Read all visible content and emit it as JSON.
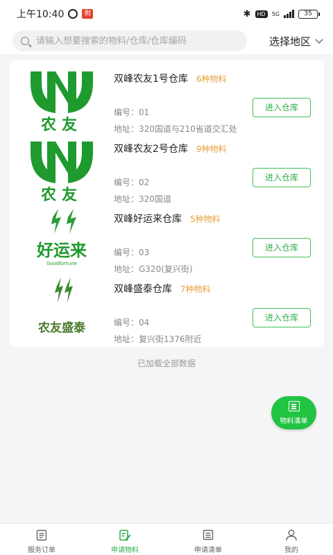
{
  "status_bar": {
    "time": "上午10:40",
    "notif_badge": "附",
    "network": "5G",
    "hd": "HD",
    "battery": "35"
  },
  "header": {
    "search_placeholder": "请输入想要搜索的物料/仓库/仓库编码",
    "region_label": "选择地区"
  },
  "warehouses": [
    {
      "name": "双峰农友1号仓库",
      "count": "6种物料",
      "code": "编号：01",
      "address": "地址：320国道与210省道交汇处",
      "button": "进入仓库",
      "logo": "nongyou-logo"
    },
    {
      "name": "双峰农友2号仓库",
      "count": "9种物料",
      "code": "编号：02",
      "address": "地址：320国道",
      "button": "进入仓库",
      "logo": "nongyou-logo"
    },
    {
      "name": "双峰好运来仓库",
      "count": "5种物料",
      "code": "编号：03",
      "address": "地址：G320(复兴街)",
      "button": "进入仓库",
      "logo": "haoyunlai-logo"
    },
    {
      "name": "双峰盛泰仓库",
      "count": "7种物料",
      "code": "编号：04",
      "address": "地址：复兴街1376附近",
      "button": "进入仓库",
      "logo": "nongyou-shengtai-logo"
    }
  ],
  "logo_text": {
    "nongyou": "农友",
    "haoyunlai": "好运来",
    "goodfortune": "Goodfortune",
    "shengtai": "农友盛泰"
  },
  "list_footer": "已加载全部数据",
  "fab": {
    "label": "物料清单"
  },
  "tabs": [
    {
      "label": "服务订单",
      "icon": "clipboard-icon"
    },
    {
      "label": "申请物料",
      "icon": "edit-document-icon"
    },
    {
      "label": "申请清单",
      "icon": "list-document-icon"
    },
    {
      "label": "我的",
      "icon": "person-icon"
    }
  ],
  "colors": {
    "accent": "#2fae49",
    "count": "#e6a03c",
    "logo_green": "#1f9a2e"
  }
}
